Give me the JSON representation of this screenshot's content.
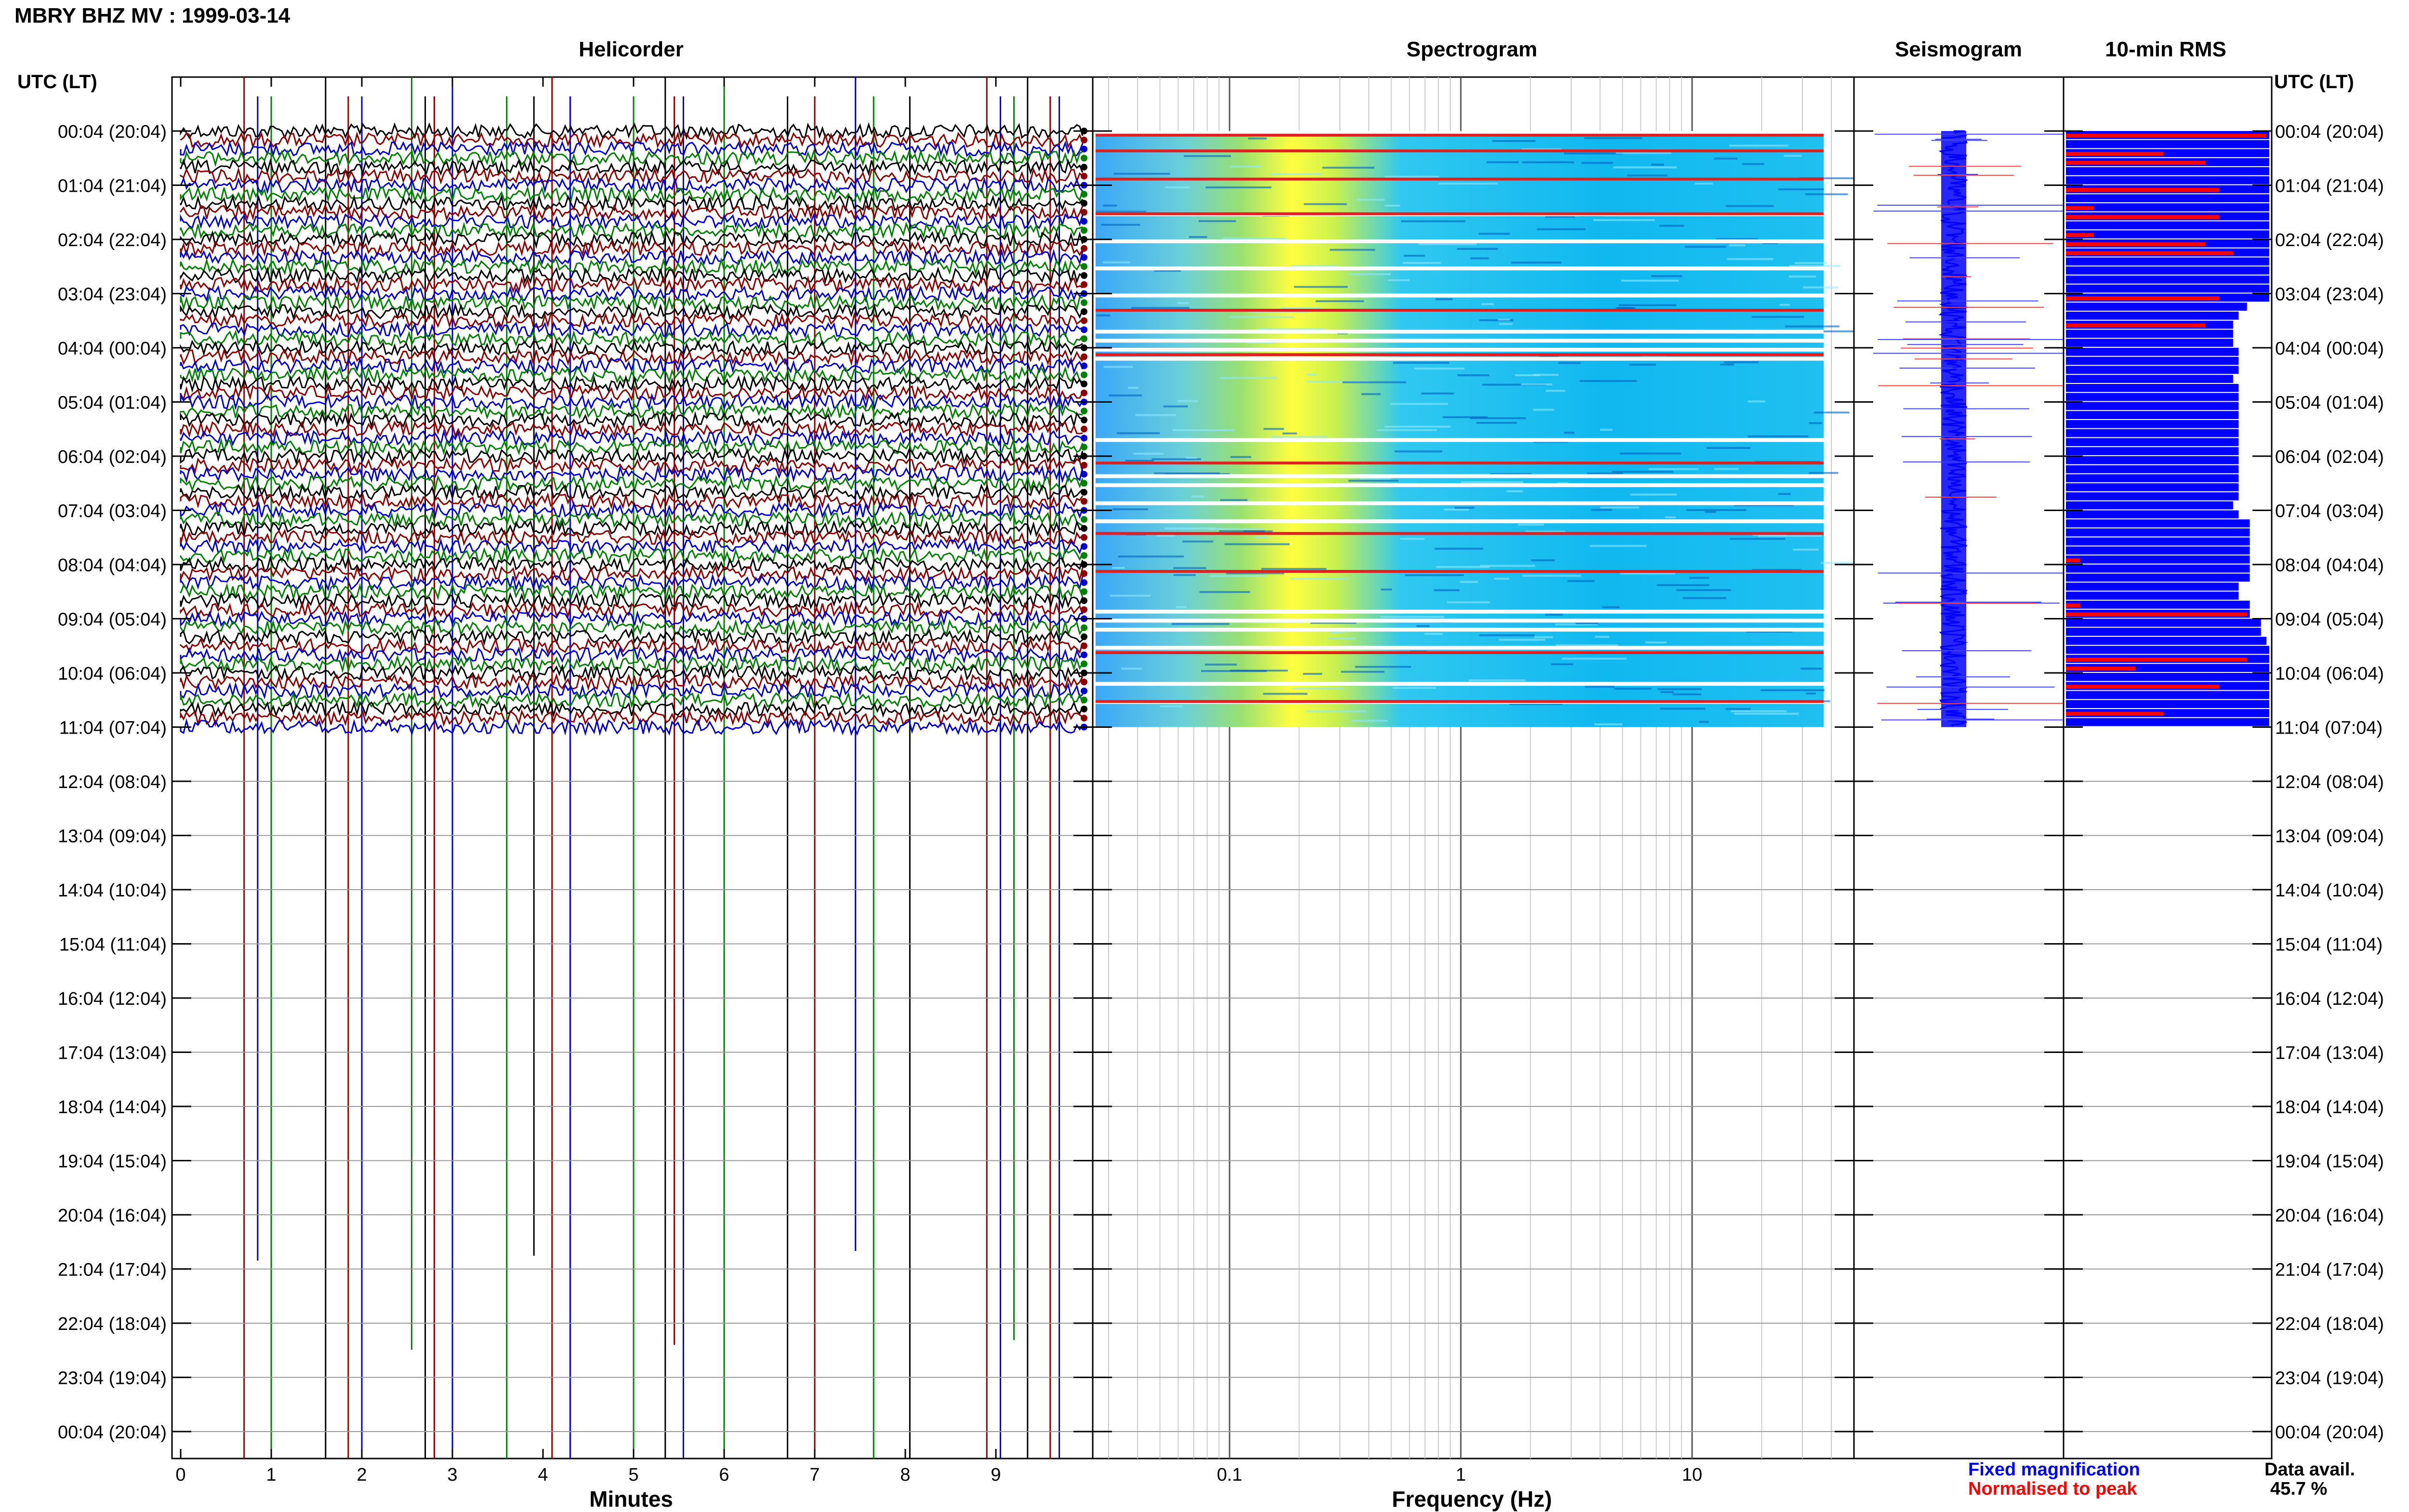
{
  "page": {
    "title": "MBRY BHZ MV : 1999-03-14",
    "time_header_left": "UTC (LT)",
    "time_header_right": "UTC (LT)"
  },
  "panels": {
    "helicorder_title": "Helicorder",
    "spectrogram_title": "Spectrogram",
    "seismogram_title": "Seismogram",
    "rms_title": "10-min RMS"
  },
  "axes": {
    "minutes_label": "Minutes",
    "frequency_label": "Frequency (Hz)",
    "minute_ticks": [
      "0",
      "1",
      "2",
      "3",
      "4",
      "5",
      "6",
      "7",
      "8",
      "9"
    ],
    "frequency_ticks": [
      "0.1",
      "1",
      "10"
    ]
  },
  "time_labels": [
    "00:04 (20:04)",
    "01:04 (21:04)",
    "02:04 (22:04)",
    "03:04 (23:04)",
    "04:04 (00:04)",
    "05:04 (01:04)",
    "06:04 (02:04)",
    "07:04 (03:04)",
    "08:04 (04:04)",
    "09:04 (05:04)",
    "10:04 (06:04)",
    "11:04 (07:04)",
    "12:04 (08:04)",
    "13:04 (09:04)",
    "14:04 (10:04)",
    "15:04 (11:04)",
    "16:04 (12:04)",
    "17:04 (13:04)",
    "18:04 (14:04)",
    "19:04 (15:04)",
    "20:04 (16:04)",
    "21:04 (17:04)",
    "22:04 (18:04)",
    "23:04 (19:04)",
    "00:04 (20:04)"
  ],
  "legend": {
    "fixed": "Fixed magnification",
    "normalised": "Normalised to peak",
    "fixed_color": "#0000ff",
    "normalised_color": "#ff0000"
  },
  "availability": {
    "label": "Data avail.",
    "value": "45.7 %"
  },
  "colors": {
    "trace_cycle": [
      "#000000",
      "#8b0000",
      "#0000cc",
      "#008000"
    ],
    "spectrogram_background": "#00c0f0",
    "spectrogram_peak": "#ffff00"
  },
  "chart_data": {
    "type": "heatmap",
    "data_hours_covered": 11,
    "traces_per_hour": 6,
    "data_availability_percent": 45.7,
    "spectrogram_frequency_range_hz": [
      0.03,
      40
    ],
    "spectrogram_dominant_band_hz": [
      0.15,
      0.35
    ],
    "rms_fixed": [
      0.73,
      0.73,
      0.73,
      0.73,
      0.73,
      0.73,
      0.73,
      0.73,
      0.73,
      0.73,
      0.73,
      0.73,
      0.73,
      0.73,
      0.73,
      0.73,
      0.73,
      0.73,
      0.73,
      0.65,
      0.62,
      0.6,
      0.6,
      0.6,
      0.62,
      0.62,
      0.62,
      0.6,
      0.62,
      0.62,
      0.62,
      0.62,
      0.62,
      0.62,
      0.62,
      0.62,
      0.62,
      0.62,
      0.62,
      0.62,
      0.62,
      0.6,
      0.62,
      0.66,
      0.66,
      0.66,
      0.66,
      0.66,
      0.66,
      0.66,
      0.62,
      0.62,
      0.66,
      0.66,
      0.7,
      0.7,
      0.72,
      0.73,
      0.73,
      0.73,
      0.73,
      0.73,
      0.73,
      0.73,
      0.73,
      0.73
    ],
    "rms_normalised": [
      0.72,
      0.0,
      0.35,
      0.5,
      0.0,
      0.0,
      0.55,
      0.0,
      0.1,
      0.55,
      0.0,
      0.1,
      0.5,
      0.6,
      0.0,
      0.0,
      0.0,
      0.0,
      0.55,
      0.0,
      0.0,
      0.5,
      0.0,
      0.0,
      0.0,
      0.0,
      0.0,
      0.0,
      0.0,
      0.0,
      0.0,
      0.0,
      0.0,
      0.0,
      0.0,
      0.0,
      0.0,
      0.0,
      0.0,
      0.0,
      0.0,
      0.0,
      0.0,
      0.0,
      0.0,
      0.0,
      0.0,
      0.05,
      0.0,
      0.0,
      0.0,
      0.0,
      0.05,
      0.65,
      0.0,
      0.0,
      0.0,
      0.0,
      0.65,
      0.25,
      0.0,
      0.55,
      0.0,
      0.0,
      0.35,
      0.0
    ],
    "event_lines_minutes": [
      0.7,
      0.85,
      1.0,
      1.6,
      1.85,
      2.0,
      2.55,
      2.7,
      2.8,
      3.0,
      3.6,
      3.9,
      4.1,
      4.3,
      5.0,
      5.35,
      5.45,
      5.55,
      6.0,
      6.7,
      7.0,
      7.45,
      7.65,
      8.05,
      8.9,
      9.05,
      9.2,
      9.35,
      9.6,
      9.7
    ]
  }
}
